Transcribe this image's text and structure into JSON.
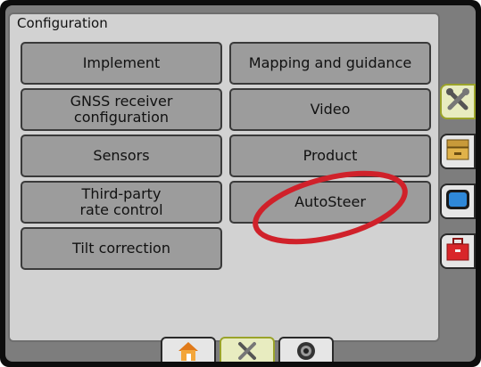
{
  "panel": {
    "title": "Configuration"
  },
  "buttons": {
    "implement": "Implement",
    "mapping": "Mapping and guidance",
    "gnss": "GNSS receiver\nconfiguration",
    "video": "Video",
    "sensors": "Sensors",
    "product": "Product",
    "third_party": "Third-party\nrate control",
    "autosteer": "AutoSteer",
    "tilt": "Tilt correction"
  },
  "icons": {
    "side_tabs": [
      "tools-icon",
      "drawer-icon",
      "display-icon",
      "toolbox-icon"
    ],
    "bottom_tabs": [
      "home-icon",
      "tools-icon",
      "camera-icon"
    ]
  },
  "colors": {
    "active_tab": "#e8ecc0",
    "highlight_ellipse": "#d0212a",
    "button": "#9c9c9c"
  }
}
